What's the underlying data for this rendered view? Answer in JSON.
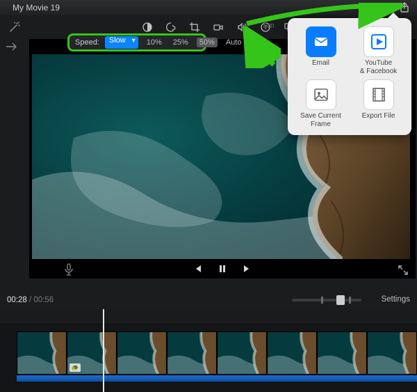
{
  "titlebar": {
    "project_title": "My Movie 19"
  },
  "share": {
    "items": [
      {
        "label": "Email",
        "icon": "email-icon"
      },
      {
        "label": "YouTube\n& Facebook",
        "icon": "youtube-icon"
      },
      {
        "label": "Save Current Frame",
        "icon": "save-frame-icon"
      },
      {
        "label": "Export File",
        "icon": "film-icon"
      }
    ]
  },
  "toolbar": {
    "sm_label": "Sm",
    "tools": [
      "color-balance",
      "color",
      "crop",
      "camera",
      "audio",
      "text",
      "overlay",
      "speed",
      "info"
    ]
  },
  "speed_panel": {
    "label": "Speed:",
    "selected_mode": "Slow",
    "options": [
      "10%",
      "25%",
      "50%",
      "Auto"
    ],
    "selected_option": "50%"
  },
  "playback": {
    "current_time": "00:28",
    "total_time": "00:56"
  },
  "timeline": {
    "settings_label": "Settings"
  },
  "colors": {
    "green": "#35c41a",
    "accent_blue": "#0a84ff"
  }
}
